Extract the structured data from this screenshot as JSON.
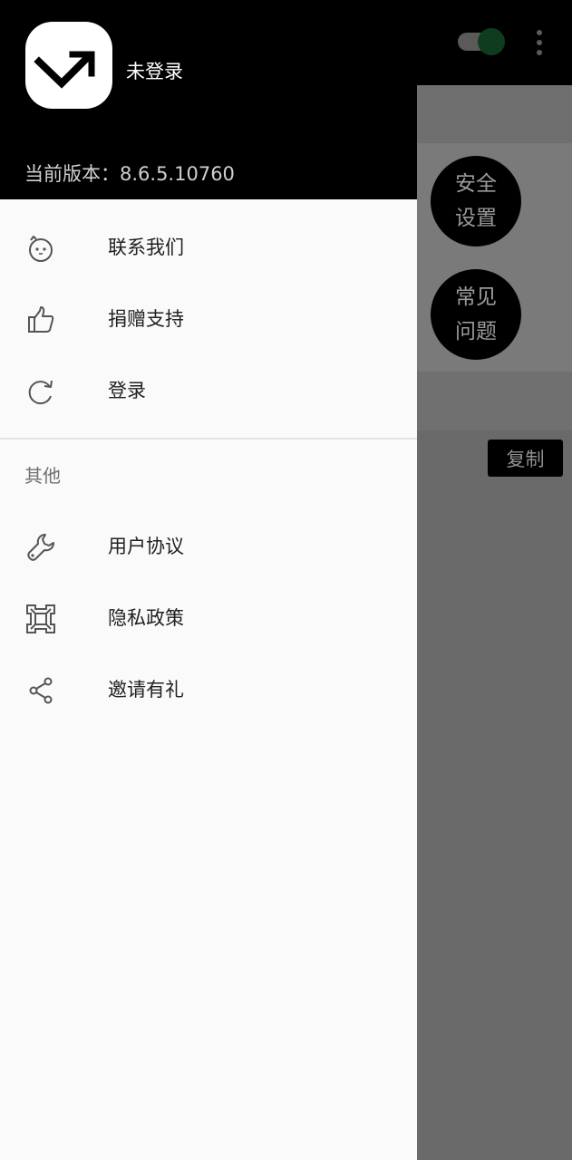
{
  "background": {
    "security_button": [
      "安全",
      "设置"
    ],
    "faq_button": [
      "常见",
      "问题"
    ],
    "copy_button": "复制"
  },
  "drawer": {
    "login_status": "未登录",
    "version": "当前版本：8.6.5.10760",
    "menu": [
      {
        "label": "联系我们",
        "icon": "face-icon"
      },
      {
        "label": "捐赠支持",
        "icon": "thumbs-up-icon"
      },
      {
        "label": "登录",
        "icon": "refresh-icon"
      }
    ],
    "section_title": "其他",
    "other": [
      {
        "label": "用户协议",
        "icon": "wrench-icon"
      },
      {
        "label": "隐私政策",
        "icon": "frame-icon"
      },
      {
        "label": "邀请有礼",
        "icon": "share-icon"
      }
    ]
  },
  "colors": {
    "header_bg": "#000000",
    "drawer_bg": "#fafafa",
    "scrim": "#6a6a6a",
    "toggle_thumb": "#0f3c1e"
  }
}
